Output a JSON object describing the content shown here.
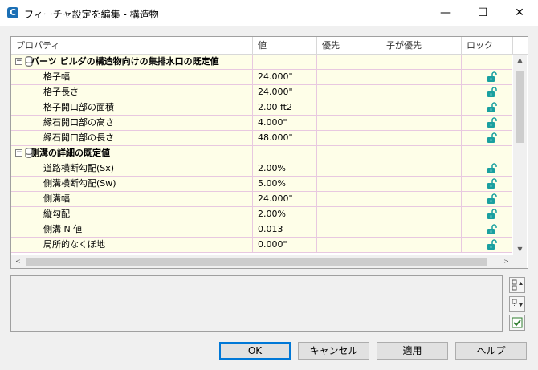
{
  "window": {
    "title": "フィーチャ設定を編集 - 構造物",
    "app_icon_letter": "C",
    "minimize": "—",
    "maximize": "☐",
    "close": "✕"
  },
  "grid": {
    "columns": [
      "プロパティ",
      "値",
      "優先",
      "子が優先",
      "ロック"
    ],
    "groups": [
      {
        "title": "パーツ ビルダの構造物向けの集排水口の既定値",
        "toggle": "−",
        "rows": [
          {
            "name": "格子幅",
            "value": "24.000\""
          },
          {
            "name": "格子長さ",
            "value": "24.000\""
          },
          {
            "name": "格子開口部の面積",
            "value": "2.00 ft2"
          },
          {
            "name": "縁石開口部の高さ",
            "value": "4.000\""
          },
          {
            "name": "縁石開口部の長さ",
            "value": "48.000\""
          }
        ]
      },
      {
        "title": "側溝の詳細の既定値",
        "toggle": "−",
        "rows": [
          {
            "name": "道路横断勾配(Sx)",
            "value": "2.00%"
          },
          {
            "name": "側溝横断勾配(Sw)",
            "value": "5.00%"
          },
          {
            "name": "側溝幅",
            "value": "24.000\""
          },
          {
            "name": "縦勾配",
            "value": "2.00%"
          },
          {
            "name": "側溝 N 値",
            "value": "0.013"
          },
          {
            "name": "局所的なくぼ地",
            "value": "0.000\""
          }
        ]
      }
    ],
    "scroll_up": "▲",
    "scroll_down": "▼",
    "scroll_left": "<",
    "scroll_right": ">"
  },
  "buttons": {
    "ok": "OK",
    "cancel": "キャンセル",
    "apply": "適用",
    "help": "ヘルプ"
  },
  "colors": {
    "row_bg": "#fefee8",
    "lock_icon": "#1aa0a0",
    "accent": "#0078d7"
  }
}
